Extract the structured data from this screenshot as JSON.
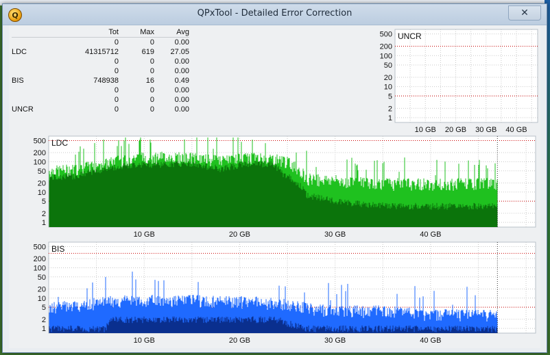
{
  "window": {
    "title": "QPxTool - Detailed Error Correction",
    "close_glyph": "✕",
    "icon_letter": "Q"
  },
  "stats_table": {
    "headers": [
      "",
      "Tot",
      "Max",
      "Avg"
    ],
    "rows": [
      [
        "",
        "0",
        "0",
        "0.00"
      ],
      [
        "LDC",
        "41315712",
        "619",
        "27.05"
      ],
      [
        "",
        "0",
        "0",
        "0.00"
      ],
      [
        "",
        "0",
        "0",
        "0.00"
      ],
      [
        "BIS",
        "748938",
        "16",
        "0.49"
      ],
      [
        "",
        "0",
        "0",
        "0.00"
      ],
      [
        "",
        "0",
        "0",
        "0.00"
      ],
      [
        "UNCR",
        "0",
        "0",
        "0.00"
      ]
    ]
  },
  "chart_data": [
    {
      "type": "area",
      "title": "UNCR",
      "y_scale": "log",
      "y_ticks": [
        1,
        2,
        5,
        10,
        20,
        50,
        100,
        200,
        500
      ],
      "x_ticks": [
        "10 GB",
        "20 GB",
        "30 GB",
        "40 GB"
      ],
      "xlim": [
        0,
        47
      ],
      "threshold_lines": [
        5,
        200
      ],
      "series": [
        {
          "values_max": [
            0,
            0,
            0,
            0,
            0
          ]
        }
      ],
      "grid": true
    },
    {
      "type": "area",
      "title": "LDC",
      "y_scale": "log",
      "y_ticks": [
        1,
        2,
        5,
        10,
        20,
        50,
        100,
        200,
        500
      ],
      "x_ticks": [
        "10 GB",
        "20 GB",
        "30 GB",
        "40 GB"
      ],
      "xlim": [
        0,
        47
      ],
      "threshold_lines": [
        5,
        500
      ],
      "disc_end_gb": 47,
      "colors": {
        "max": "#1fc11f",
        "avg": "#0b740b"
      },
      "series": [
        {
          "name": "max",
          "x": [
            0,
            3,
            6,
            9,
            12,
            15,
            18,
            21,
            23.5,
            24.5,
            27,
            30,
            33,
            36,
            39,
            42,
            45,
            47
          ],
          "values": [
            50,
            60,
            90,
            140,
            150,
            140,
            110,
            140,
            130,
            120,
            30,
            25,
            22,
            20,
            20,
            20,
            20,
            20
          ]
        },
        {
          "name": "avg",
          "x": [
            0,
            3,
            6,
            9,
            12,
            15,
            18,
            21,
            23.5,
            24.5,
            27,
            30,
            33,
            36,
            39,
            42,
            45,
            47
          ],
          "values": [
            30,
            35,
            60,
            80,
            85,
            85,
            60,
            90,
            85,
            40,
            8,
            5,
            4,
            3.5,
            3.5,
            3.5,
            3.5,
            3.5
          ]
        }
      ],
      "grid": true
    },
    {
      "type": "area",
      "title": "BIS",
      "y_scale": "log",
      "y_ticks": [
        1,
        2,
        5,
        10,
        20,
        50,
        100,
        200,
        500
      ],
      "x_ticks": [
        "10 GB",
        "20 GB",
        "30 GB",
        "40 GB"
      ],
      "xlim": [
        0,
        47
      ],
      "threshold_lines": [
        5,
        300
      ],
      "disc_end_gb": 47,
      "colors": {
        "max": "#1f6aff",
        "avg": "#0a2f8e"
      },
      "series": [
        {
          "name": "max",
          "x": [
            0,
            3,
            6,
            9,
            12,
            15,
            18,
            21,
            24,
            27,
            30,
            33,
            36,
            39,
            42,
            45,
            47
          ],
          "values": [
            5,
            6,
            8,
            9,
            9,
            9,
            8,
            8,
            7,
            5,
            4,
            4,
            4,
            3,
            3,
            3,
            3
          ]
        },
        {
          "name": "avg",
          "x": [
            0,
            3,
            6,
            6.5,
            9,
            12,
            15,
            18,
            21,
            24,
            25,
            27,
            30,
            33,
            36,
            39,
            42,
            45,
            47
          ],
          "values": [
            1,
            1,
            1,
            2,
            2,
            2,
            2,
            2,
            2,
            2,
            1.5,
            1,
            1,
            1,
            1,
            1,
            1,
            1,
            1
          ]
        }
      ],
      "grid": true
    }
  ]
}
